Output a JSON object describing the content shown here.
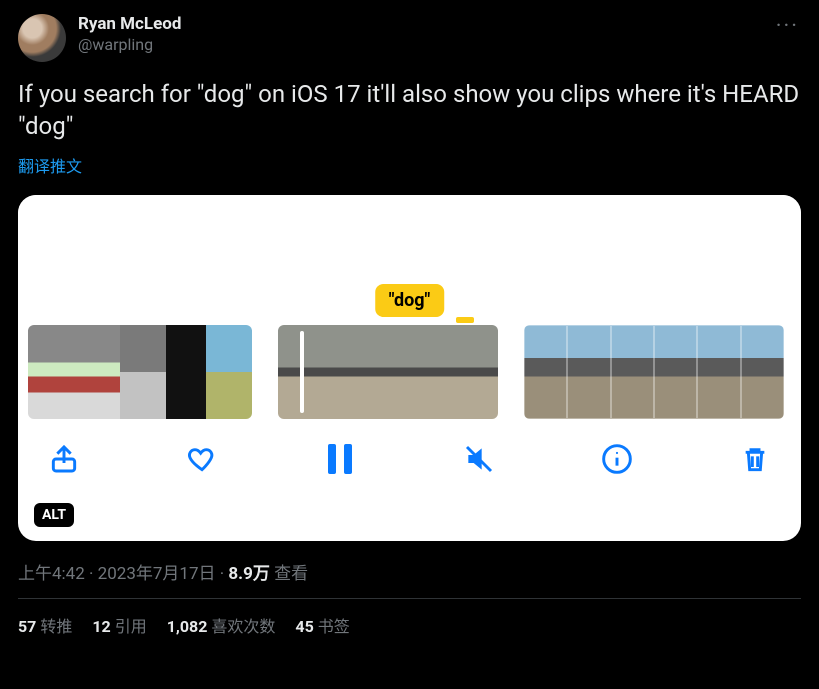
{
  "author": {
    "display_name": "Ryan McLeod",
    "handle": "@warpling"
  },
  "more_glyph": "···",
  "content_text": "If you search for \"dog\" on iOS 17 it'll also show you clips where it's HEARD \"dog\"",
  "translate_label": "翻译推文",
  "media": {
    "search_badge": "\"dog\"",
    "alt_badge": "ALT",
    "actions": {
      "share": "share",
      "like": "like",
      "pause": "pause",
      "mute": "muted",
      "info": "info",
      "delete": "delete"
    }
  },
  "meta": {
    "time": "上午4:42",
    "sep1": " · ",
    "date": "2023年7月17日",
    "sep2": " · ",
    "views_value": "8.9万",
    "views_label": " 查看"
  },
  "stats": {
    "retweets": {
      "count": "57",
      "label": "转推"
    },
    "quotes": {
      "count": "12",
      "label": "引用"
    },
    "likes": {
      "count": "1,082",
      "label": "喜欢次数"
    },
    "bookmarks": {
      "count": "45",
      "label": "书签"
    }
  }
}
